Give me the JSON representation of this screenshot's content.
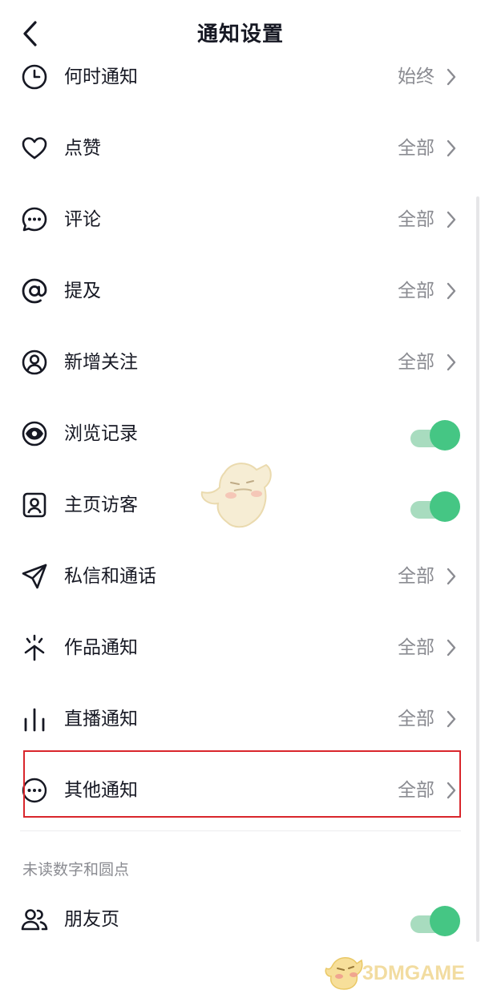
{
  "header": {
    "title": "通知设置",
    "back_icon": "chevron-left-icon"
  },
  "rows": [
    {
      "icon": "clock-icon",
      "label": "何时通知",
      "value": "始终",
      "control": "chevron"
    },
    {
      "icon": "heart-icon",
      "label": "点赞",
      "value": "全部",
      "control": "chevron"
    },
    {
      "icon": "comment-icon",
      "label": "评论",
      "value": "全部",
      "control": "chevron"
    },
    {
      "icon": "at-icon",
      "label": "提及",
      "value": "全部",
      "control": "chevron"
    },
    {
      "icon": "user-circle-icon",
      "label": "新增关注",
      "value": "全部",
      "control": "chevron"
    },
    {
      "icon": "eye-icon",
      "label": "浏览记录",
      "toggle_on": true,
      "control": "toggle"
    },
    {
      "icon": "user-square-icon",
      "label": "主页访客",
      "toggle_on": true,
      "control": "toggle"
    },
    {
      "icon": "send-icon",
      "label": "私信和通话",
      "value": "全部",
      "control": "chevron"
    },
    {
      "icon": "sparkle-icon",
      "label": "作品通知",
      "value": "全部",
      "control": "chevron"
    },
    {
      "icon": "live-bars-icon",
      "label": "直播通知",
      "value": "全部",
      "control": "chevron"
    },
    {
      "icon": "more-circle-icon",
      "label": "其他通知",
      "value": "全部",
      "control": "chevron",
      "highlighted": true
    }
  ],
  "section": {
    "label": "未读数字和圆点",
    "rows": [
      {
        "icon": "friends-icon",
        "label": "朋友页",
        "toggle_on": true,
        "control": "toggle"
      }
    ]
  },
  "watermark": {
    "text": "3DMGAME"
  },
  "colors": {
    "toggle_on": "#45c684",
    "highlight_border": "#d9262c",
    "secondary_text": "#8a8b91",
    "text": "#161823"
  }
}
